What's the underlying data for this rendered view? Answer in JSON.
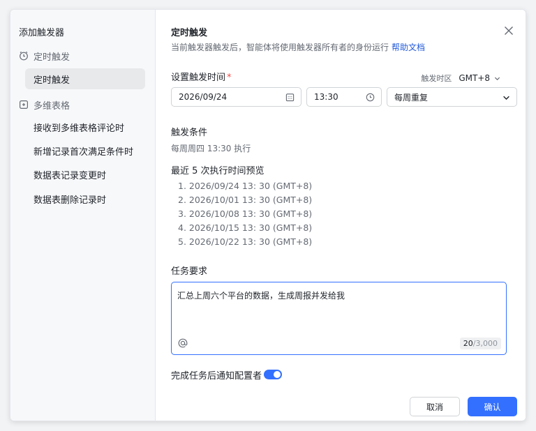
{
  "sidebar": {
    "title": "添加触发器",
    "groups": [
      {
        "label": "定时触发",
        "items": [
          "定时触发"
        ]
      },
      {
        "label": "多维表格",
        "items": [
          "接收到多维表格评论时",
          "新增记录首次满足条件时",
          "数据表记录变更时",
          "数据表删除记录时"
        ]
      }
    ]
  },
  "header": {
    "title": "定时触发",
    "subtitle": "当前触发器触发后，智能体将使用触发器所有者的身份运行",
    "help_link": "帮助文档"
  },
  "schedule": {
    "label": "设置触发时间",
    "required_mark": "*",
    "timezone_label": "触发时区",
    "timezone_value": "GMT+8",
    "date_value": "2026/09/24",
    "time_value": "13:30",
    "repeat_value": "每周重复"
  },
  "condition": {
    "label": "触发条件",
    "value": "每周周四 13:30 执行"
  },
  "preview": {
    "label": "最近 5 次执行时间预览",
    "items": [
      "1. 2026/09/24 13: 30 (GMT+8)",
      "2. 2026/10/01 13: 30 (GMT+8)",
      "3. 2026/10/08 13: 30 (GMT+8)",
      "4. 2026/10/15 13: 30 (GMT+8)",
      "5. 2026/10/22 13: 30 (GMT+8)"
    ]
  },
  "task": {
    "label": "任务要求",
    "value": "汇总上周六个平台的数据，生成周报并发给我",
    "count_current": "20",
    "count_max": "/3,000"
  },
  "notify": {
    "label": "完成任务后通知配置者",
    "enabled": true
  },
  "footer": {
    "cancel": "取消",
    "confirm": "确认"
  },
  "colors": {
    "accent": "#3370ff",
    "link": "#245bdb",
    "required": "#f54a45"
  }
}
